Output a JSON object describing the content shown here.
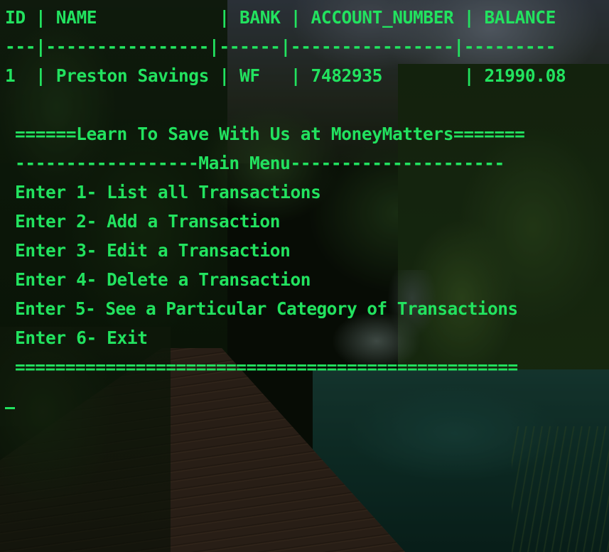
{
  "terminal": {
    "text_color": "#22e25f",
    "table": {
      "header": "ID | NAME            | BANK | ACCOUNT_NUMBER | BALANCE",
      "separator": "---|----------------|------|----------------|---------",
      "rows": [
        "1  | Preston Savings | WF   | 7482935        | 21990.08"
      ]
    },
    "menu": {
      "banner": "======Learn To Save With Us at MoneyMatters=======",
      "title": "------------------Main Menu---------------------",
      "options": [
        "Enter 1- List all Transactions",
        "Enter 2- Add a Transaction",
        "Enter 3- Edit a Transaction",
        "Enter 4- Delete a Transaction",
        "Enter 5- See a Particular Category of Transactions",
        "Enter 6- Exit"
      ],
      "footer": "=================================================="
    }
  }
}
